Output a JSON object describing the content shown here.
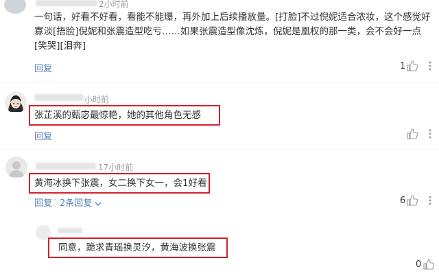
{
  "comments": [
    {
      "time": "2小时前",
      "text": "一句话，好看不好看，看能不能爆，再外加上后续播放量。[打脸]不过倪妮适合浓妆，这个感觉好寡淡[捂脸]倪妮和张震造型吃亏……如果张震造型像沈炼，倪妮是凰权的那一类，会不会好一点[笑哭][泪奔]",
      "reply_label": "回复",
      "likes": "1"
    },
    {
      "time": "小时前",
      "text": "张芷溪的甄宓最惊艳，她的其他角色无感",
      "reply_label": "回复"
    },
    {
      "time": "17小时前",
      "text": "黄海冰换下张震，女二换下女一，会1好看",
      "reply_label": "回复",
      "replies_label": "2条回复",
      "likes": "6"
    }
  ],
  "sub_reply": {
    "text": "同意，跪求青瑶换灵汐，黄海波换张震",
    "likes": "0"
  },
  "colors": {
    "highlight": "#d81e2a",
    "link": "#5a82b6"
  }
}
